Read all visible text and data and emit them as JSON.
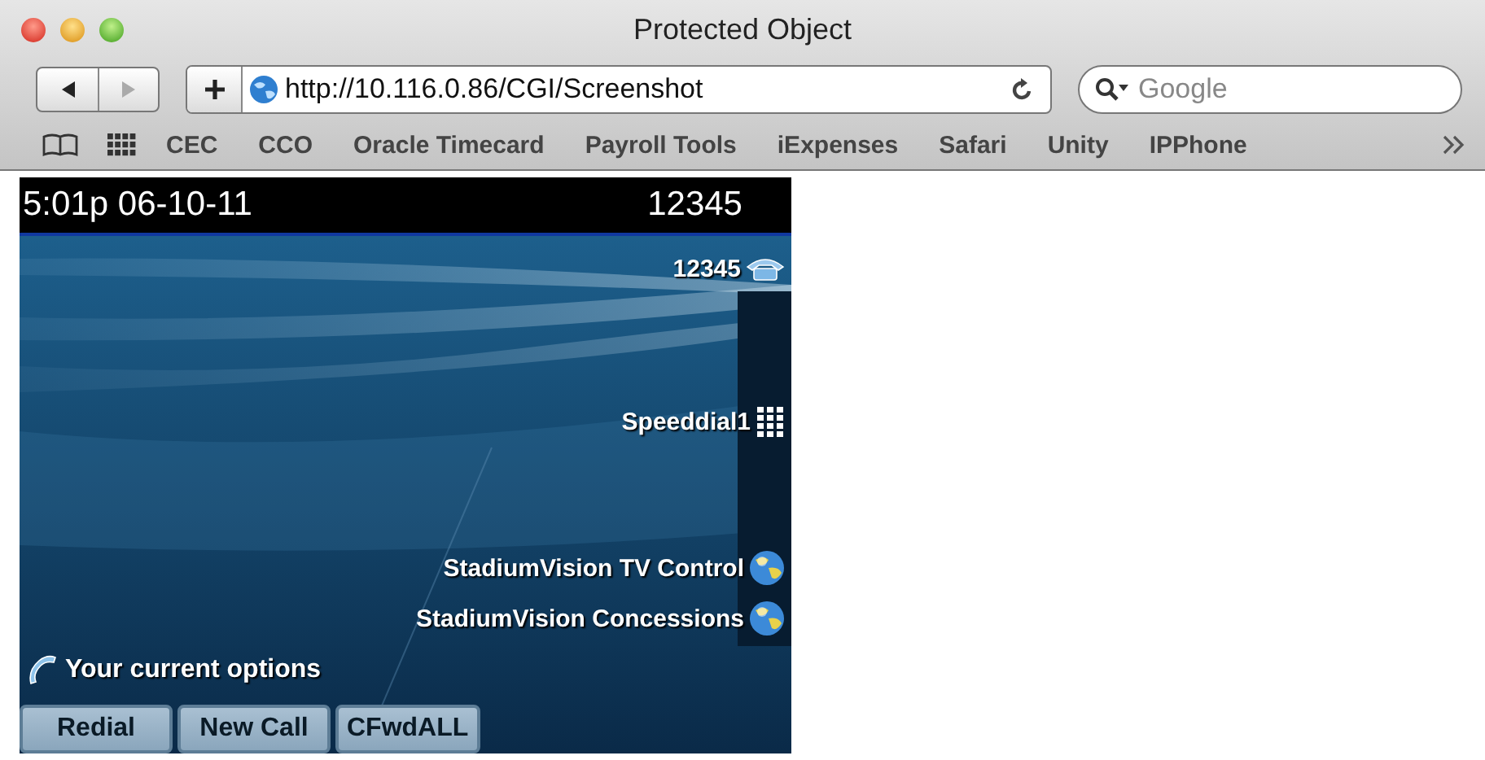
{
  "window": {
    "title": "Protected Object"
  },
  "toolbar": {
    "url": "http://10.116.0.86/CGI/Screenshot",
    "search": {
      "placeholder": "Google"
    }
  },
  "bookmarks": [
    "CEC",
    "CCO",
    "Oracle Timecard",
    "Payroll Tools",
    "iExpenses",
    "Safari",
    "Unity",
    "IPPhone"
  ],
  "phone": {
    "status_bar": {
      "datetime": "5:01p 06-10-11",
      "extension": "12345"
    },
    "lines": [
      {
        "kind": "line",
        "label": "12345"
      },
      {
        "kind": "speeddial",
        "label": "Speeddial1"
      },
      {
        "kind": "service",
        "label": "StadiumVision TV Control"
      },
      {
        "kind": "service",
        "label": "StadiumVision Concessions"
      }
    ],
    "prompt": "Your current options",
    "softkeys": [
      "Redial",
      "New Call",
      "CFwdALL"
    ]
  }
}
